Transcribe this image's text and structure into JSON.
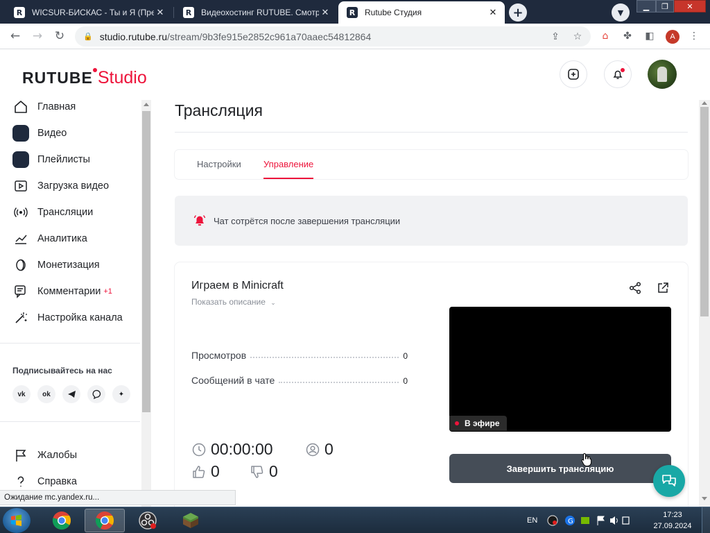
{
  "browser": {
    "tabs": [
      {
        "favicon": "R",
        "title": "WICSUR-БИСКАС - Ты и Я (Пре"
      },
      {
        "favicon": "R",
        "title": "Видеохостинг RUTUBE. Смотрит"
      },
      {
        "favicon": "R",
        "title": "Rutube Студия"
      }
    ],
    "url_host": "studio.rutube.ru",
    "url_path": "/stream/9b3fe915e2852c961a70aaec54812864",
    "profile_initial": "A",
    "status_text": "Ожидание mc.yandex.ru..."
  },
  "app": {
    "logo_main": "RUTUBE",
    "logo_sub": "Studio",
    "accent_color": "#ed143b"
  },
  "sidebar": {
    "items": [
      {
        "label": "Главная",
        "icon": "home-icon"
      },
      {
        "label": "Видео",
        "icon": "video-icon"
      },
      {
        "label": "Плейлисты",
        "icon": "playlist-icon"
      },
      {
        "label": "Загрузка видео",
        "icon": "upload-icon"
      },
      {
        "label": "Трансляции",
        "icon": "broadcast-icon"
      },
      {
        "label": "Аналитика",
        "icon": "analytics-icon"
      },
      {
        "label": "Монетизация",
        "icon": "monetization-icon"
      },
      {
        "label": "Комментарии",
        "icon": "comments-icon",
        "badge": "+1"
      },
      {
        "label": "Настройка канала",
        "icon": "magic-wand-icon"
      }
    ],
    "subscribe_label": "Подписывайтесь на нас",
    "socials": [
      "vk",
      "ok",
      "telegram",
      "viber",
      "more"
    ],
    "bottom_items": [
      {
        "label": "Жалобы",
        "icon": "flag-icon"
      },
      {
        "label": "Справка",
        "icon": "help-icon"
      }
    ]
  },
  "main": {
    "title": "Трансляция",
    "tabs": [
      {
        "label": "Настройки",
        "active": false
      },
      {
        "label": "Управление",
        "active": true
      }
    ],
    "notice": "Чат сотрётся после завершения трансляции",
    "stream": {
      "title": "Играем в Minicraft",
      "show_description": "Показать описание",
      "stats": [
        {
          "label": "Просмотров",
          "value": "0"
        },
        {
          "label": "Сообщений в чате",
          "value": "0"
        }
      ],
      "live_label": "В эфире",
      "duration": "00:00:00",
      "viewers_now": "0",
      "likes": "0",
      "dislikes": "0",
      "end_button": "Завершить трансляцию"
    }
  },
  "taskbar": {
    "lang": "EN",
    "time": "17:23",
    "date": "27.09.2024"
  }
}
